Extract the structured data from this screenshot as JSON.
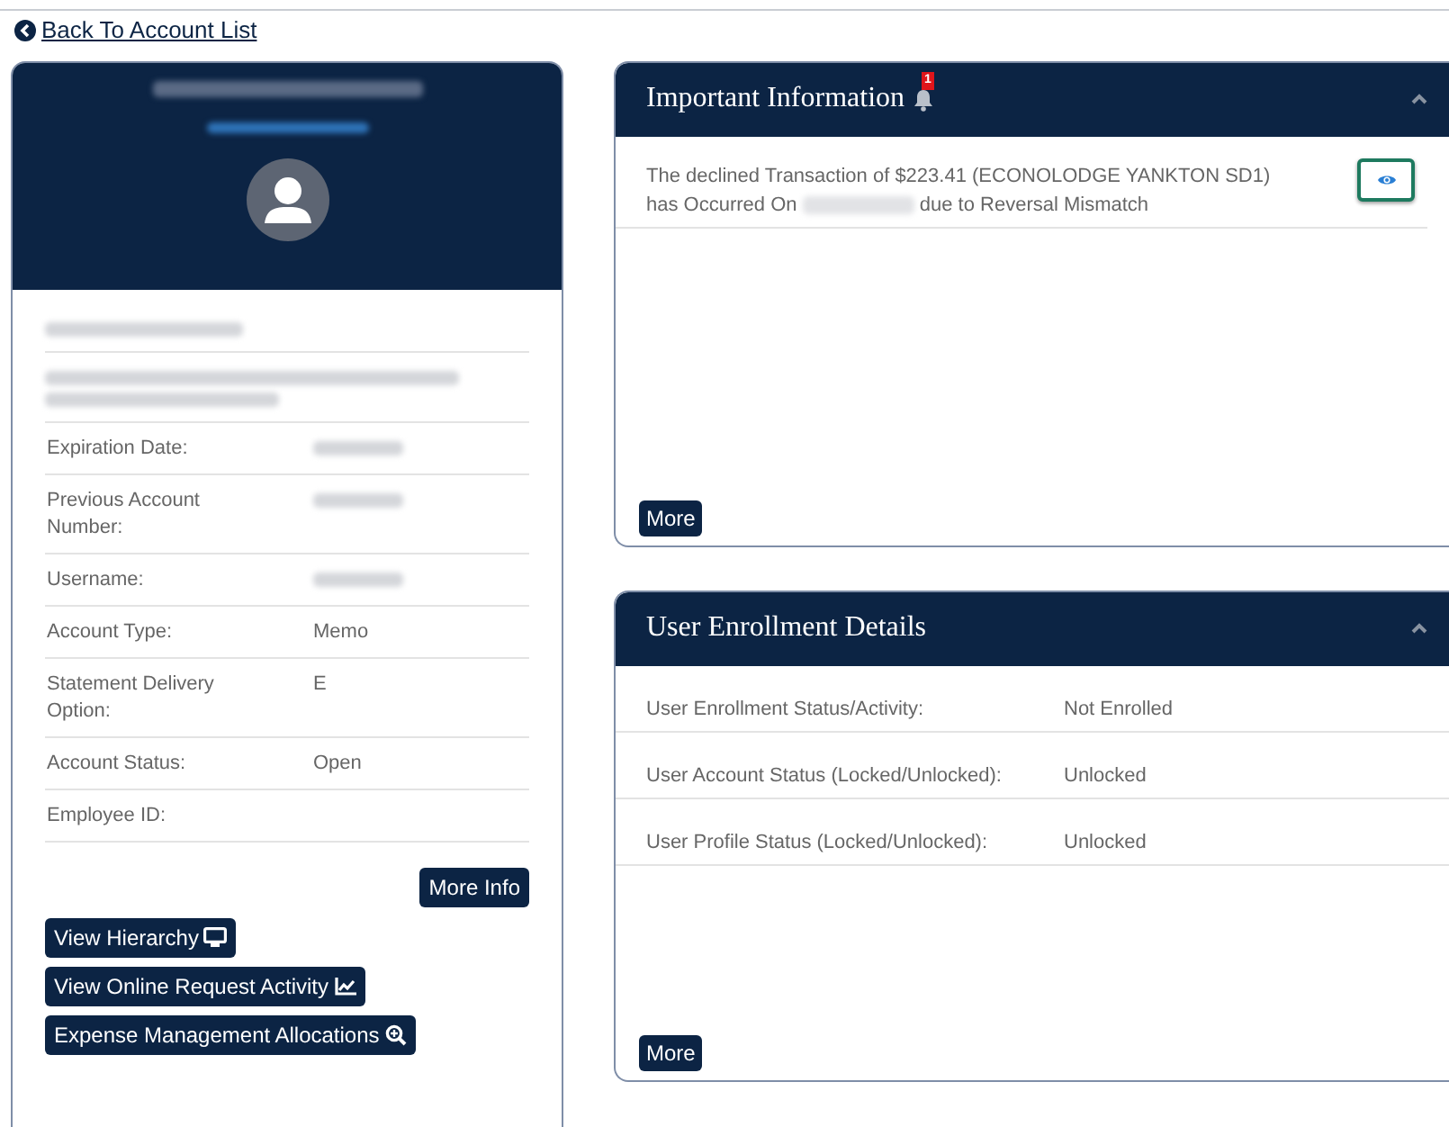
{
  "back_link": {
    "label": "Back To Account List"
  },
  "account_card": {
    "rows": [
      {
        "label": "Expiration Date:",
        "kind": "redacted"
      },
      {
        "label": "Previous Account Number:",
        "kind": "redacted"
      },
      {
        "label": "Username:",
        "kind": "redacted"
      },
      {
        "label": "Account Type:",
        "kind": "text",
        "value": "Memo"
      },
      {
        "label": "Statement Delivery Option:",
        "kind": "text",
        "value": "E"
      },
      {
        "label": "Account Status:",
        "kind": "text",
        "value": "Open"
      },
      {
        "label": "Employee ID:",
        "kind": "empty"
      }
    ],
    "more_button": "More Info",
    "actions": [
      {
        "label": "View Hierarchy",
        "kind": "hierarchy"
      },
      {
        "label": "View Online Request Activity",
        "kind": "activity"
      },
      {
        "label": "Expense Management Allocations",
        "kind": "allocations"
      }
    ]
  },
  "important_information": {
    "title": "Important Information",
    "badge": "1",
    "expanded": true,
    "messages": [
      {
        "text_start": "The declined Transaction of $223.41 (ECONOLODGE YANKTON SD1) has Occurred On",
        "text_end": "due to Reversal Mismatch"
      }
    ],
    "more_button": "More"
  },
  "user_enrollment": {
    "title": "User Enrollment Details",
    "expanded": true,
    "rows": [
      {
        "label": "User Enrollment Status/Activity:",
        "value": "Not Enrolled"
      },
      {
        "label": "User Account Status (Locked/Unlocked):",
        "value": "Unlocked"
      },
      {
        "label": "User Profile Status (Locked/Unlocked):",
        "value": "Unlocked"
      }
    ],
    "more_button": "More"
  }
}
